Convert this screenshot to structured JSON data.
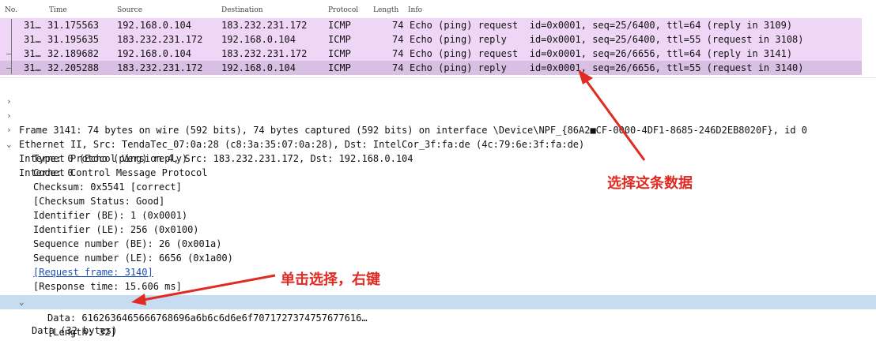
{
  "packet_list": {
    "columns": {
      "no": "No.",
      "time": "Time",
      "source": "Source",
      "destination": "Destination",
      "protocol": "Protocol",
      "length": "Length",
      "info": "Info"
    },
    "rows": [
      {
        "no": "31…",
        "time": "31.175563",
        "source": "192.168.0.104",
        "destination": "183.232.231.172",
        "protocol": "ICMP",
        "length": "74",
        "info": "Echo (ping) request  id=0x0001, seq=25/6400, ttl=64 (reply in 3109)"
      },
      {
        "no": "31…",
        "time": "31.195635",
        "source": "183.232.231.172",
        "destination": "192.168.0.104",
        "protocol": "ICMP",
        "length": "74",
        "info": "Echo (ping) reply    id=0x0001, seq=25/6400, ttl=55 (request in 3108)"
      },
      {
        "no": "31…",
        "time": "32.189682",
        "source": "192.168.0.104",
        "destination": "183.232.231.172",
        "protocol": "ICMP",
        "length": "74",
        "info": "Echo (ping) request  id=0x0001, seq=26/6656, ttl=64 (reply in 3141)"
      },
      {
        "no": "31…",
        "time": "32.205288",
        "source": "183.232.231.172",
        "destination": "192.168.0.104",
        "protocol": "ICMP",
        "length": "74",
        "info": "Echo (ping) reply    id=0x0001, seq=26/6656, ttl=55 (request in 3140)"
      }
    ]
  },
  "details": {
    "frame": "Frame 3141: 74 bytes on wire (592 bits), 74 bytes captured (592 bits) on interface \\Device\\NPF_{86A2■CF-0000-4DF1-8685-246D2EB8020F}, id 0",
    "ethernet": "Ethernet II, Src: TendaTec_07:0a:28 (c8:3a:35:07:0a:28), Dst: IntelCor_3f:fa:de (4c:79:6e:3f:fa:de)",
    "ip": "Internet Protocol Version 4, Src: 183.232.231.172, Dst: 192.168.0.104",
    "icmp": "Internet Control Message Protocol",
    "icmp_fields": {
      "type": "Type: 0 (Echo (ping) reply)",
      "code": "Code: 0",
      "checksum": "Checksum: 0x5541 [correct]",
      "checksum_status": "[Checksum Status: Good]",
      "id_be": "Identifier (BE): 1 (0x0001)",
      "id_le": "Identifier (LE): 256 (0x0100)",
      "seq_be": "Sequence number (BE): 26 (0x001a)",
      "seq_le": "Sequence number (LE): 6656 (0x1a00)",
      "request_frame": "[Request frame: 3140]",
      "response_time": "[Response time: 15.606 ms]"
    },
    "data_node": "Data (32 bytes)",
    "data_value": "Data: 6162636465666768696a6b6c6d6e6f7071727374757677616…",
    "data_length": "[Length: 32]"
  },
  "annotations": {
    "select_row": "选择这条数据",
    "click_right": "单击选择，右键"
  },
  "colors": {
    "icmp_row": "#f0d6f6",
    "selected_row": "#d9bfe3",
    "highlight": "#c5dcf1",
    "annotation": "#e02a22"
  }
}
